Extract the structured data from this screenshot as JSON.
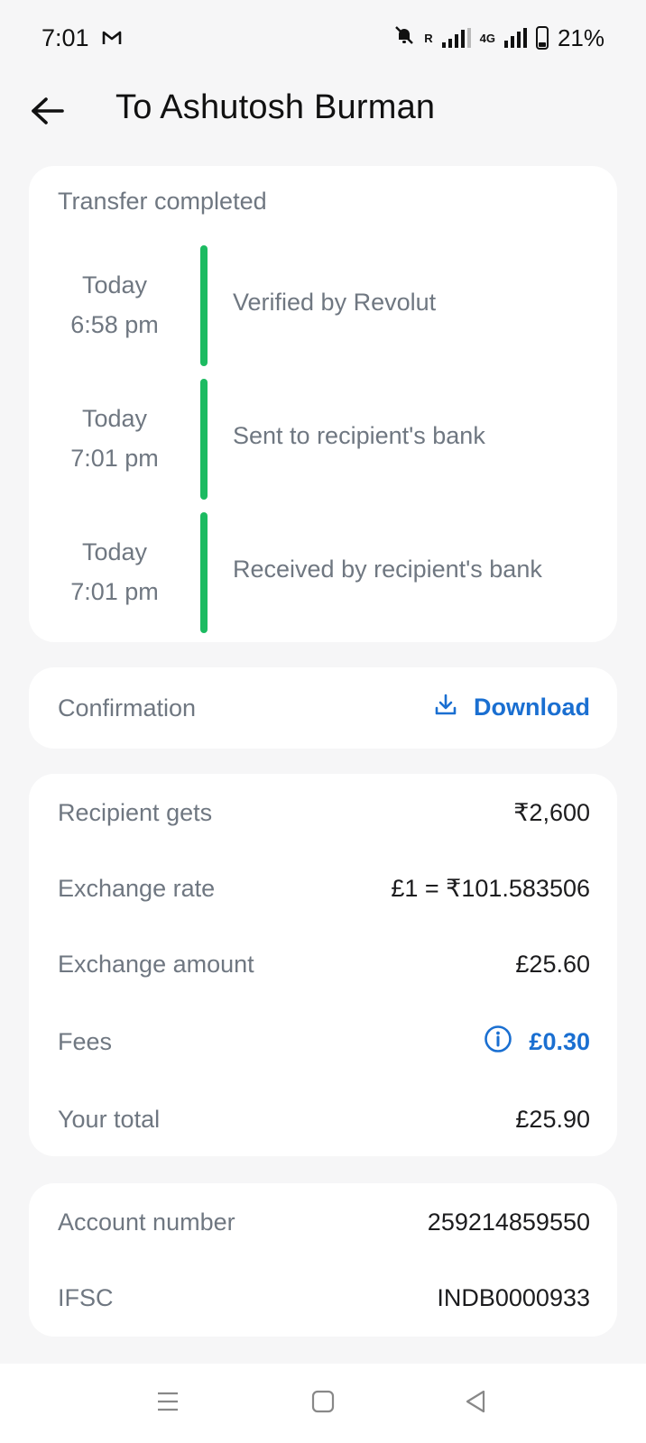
{
  "status_bar": {
    "time": "7:01",
    "mail_icon": "gmail-icon",
    "roaming": "R",
    "network": "4G",
    "battery": "21%"
  },
  "header": {
    "back_icon": "arrow-left-icon",
    "title": "To Ashutosh Burman"
  },
  "timeline": {
    "title": "Transfer completed",
    "accent_color": "#1cbb61",
    "steps": [
      {
        "day": "Today",
        "time": "6:58 pm",
        "label": "Verified by Revolut"
      },
      {
        "day": "Today",
        "time": "7:01 pm",
        "label": "Sent to recipient's bank"
      },
      {
        "day": "Today",
        "time": "7:01 pm",
        "label": "Received by recipient's bank"
      }
    ]
  },
  "confirmation": {
    "label": "Confirmation",
    "download_label": "Download",
    "download_icon": "download-icon"
  },
  "amounts": {
    "recipient_gets": {
      "label": "Recipient gets",
      "value": "₹2,600"
    },
    "exchange_rate": {
      "label": "Exchange rate",
      "value": "£1 = ₹101.583506"
    },
    "exchange_amount": {
      "label": "Exchange amount",
      "value": "£25.60"
    },
    "fees": {
      "label": "Fees",
      "value": "£0.30",
      "icon": "info-icon"
    },
    "total": {
      "label": "Your total",
      "value": "£25.90"
    }
  },
  "account": {
    "account_number": {
      "label": "Account number",
      "value": "259214859550"
    },
    "ifsc": {
      "label": "IFSC",
      "value": "INDB0000933"
    }
  },
  "nav": {
    "menu_icon": "menu-icon",
    "home_icon": "home-square-icon",
    "back_icon": "back-triangle-icon"
  },
  "colors": {
    "accent_blue": "#1a6fd1",
    "success_green": "#1cbb61",
    "background": "#f6f6f7"
  }
}
